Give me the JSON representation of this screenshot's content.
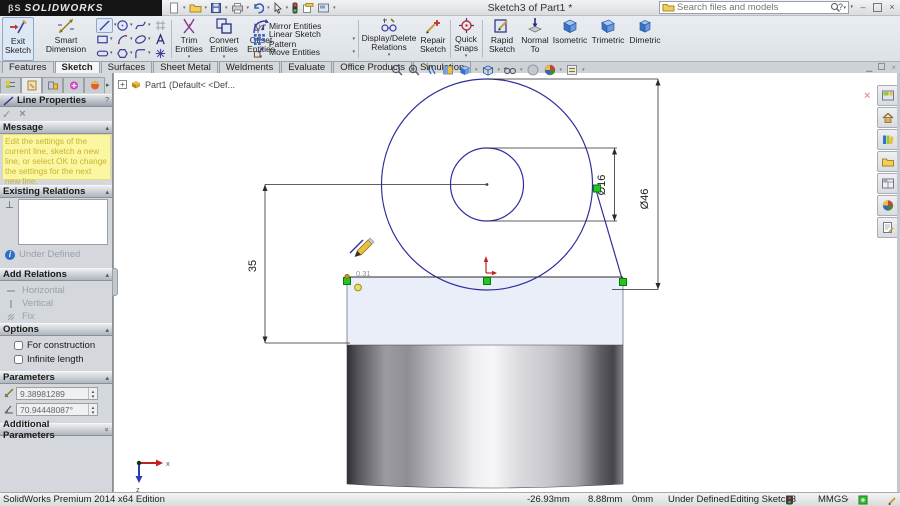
{
  "window": {
    "logo": "SOLIDWORKS",
    "title": "Sketch3 of Part1 *",
    "search_placeholder": "Search files and models"
  },
  "ribbon": {
    "exit_sketch": "Exit Sketch",
    "smart_dimension": "Smart Dimension",
    "trim": "Trim Entities",
    "convert": "Convert Entities",
    "offset": "Offset Entities",
    "mirror": "Mirror Entities",
    "linear_pattern": "Linear Sketch Pattern",
    "move": "Move Entities",
    "display_delete": "Display/Delete Relations",
    "repair": "Repair Sketch",
    "quick_snaps": "Quick Snaps",
    "rapid_sketch": "Rapid Sketch",
    "normal_to": "Normal To",
    "isometric": "Isometric",
    "trimetric": "Trimetric",
    "dimetric": "Dimetric"
  },
  "tabs": {
    "active": "Sketch",
    "items": [
      {
        "label": "Features"
      },
      {
        "label": "Sketch"
      },
      {
        "label": "Surfaces"
      },
      {
        "label": "Sheet Metal"
      },
      {
        "label": "Weldments"
      },
      {
        "label": "Evaluate"
      },
      {
        "label": "Office Products"
      },
      {
        "label": "Simulation"
      }
    ]
  },
  "feature_tree": {
    "expander": "+",
    "root_label": "Part1  (Default< <Def..."
  },
  "panel": {
    "title": "Line Properties",
    "help_glyph": "?",
    "ok_glyph": "✓",
    "cancel_glyph": "×",
    "message_header": "Message",
    "message_text": "Edit the settings of the current line, sketch a new line, or select OK to change the settings for the next new line.",
    "existing_header": "Existing Relations",
    "relation_icon": "⊥",
    "status": "Under Defined",
    "add_header": "Add Relations",
    "relations": [
      {
        "label": "Horizontal"
      },
      {
        "label": "Vertical"
      },
      {
        "label": "Fix"
      }
    ],
    "options_header": "Options",
    "options": [
      {
        "label": "For construction"
      },
      {
        "label": "Infinite length"
      }
    ],
    "parameters_header": "Parameters",
    "param_length": "9.38981289",
    "param_angle": "70.94448087°",
    "additional_header": "Additional Parameters",
    "collapse_glyph": "«"
  },
  "canvas": {
    "dim_small": "Ø16",
    "dim_large": "Ø46",
    "dim_height": "35",
    "hint": "0.31",
    "triad_x": "x",
    "triad_z": "z"
  },
  "statusbar": {
    "product": "SolidWorks Premium 2014 x64 Edition",
    "x": "-26.93mm",
    "y": "8.88mm",
    "z": "0mm",
    "state": "Under Defined",
    "editing": "Editing Sketch3",
    "units": "MMGS"
  },
  "icons": {
    "quick_access": [
      "new",
      "open",
      "save",
      "print",
      "undo",
      "select",
      "rebuild",
      "copy-settings",
      "image"
    ],
    "headsup": [
      "zoom-fit",
      "zoom-area",
      "previous-view",
      "section-view",
      "view-orientation",
      "display-style",
      "hide-show-items",
      "edit-appearance",
      "apply-scene",
      "view-settings"
    ],
    "taskpane": [
      "resources-window",
      "home",
      "design-library",
      "file-explorer",
      "view-palette",
      "appearances",
      "custom-properties"
    ]
  },
  "colors": {
    "sketch_blue": "#2e2e9e",
    "marker_green": "#00b400",
    "face_blue": "#e9eef8",
    "message_yellow": "#fbf6a2",
    "highlight_orange": "#d8861e"
  }
}
